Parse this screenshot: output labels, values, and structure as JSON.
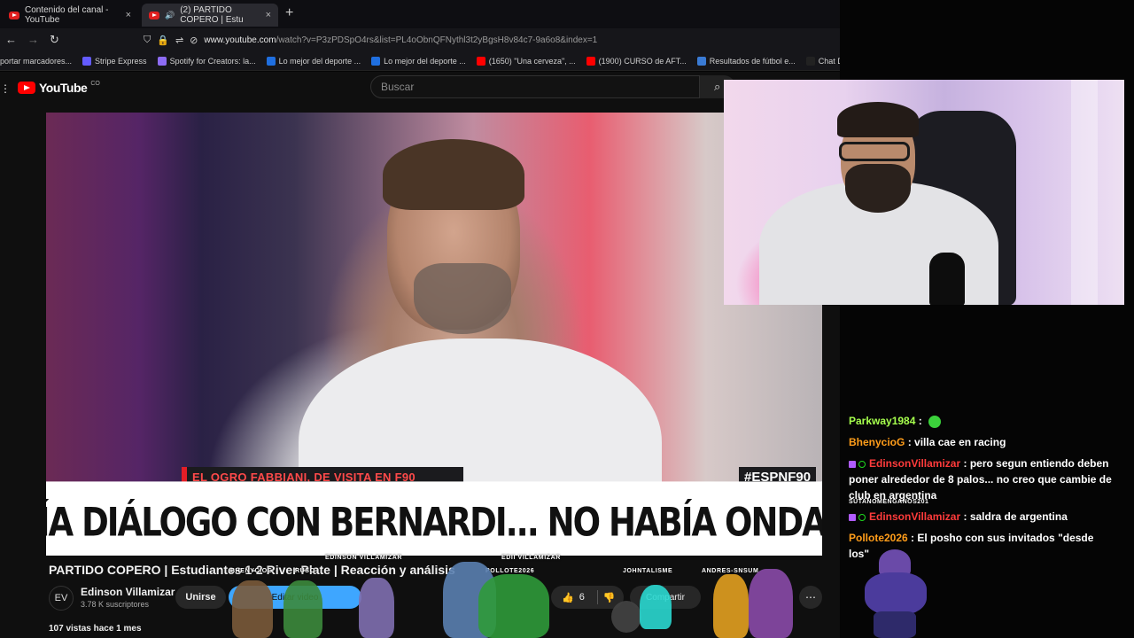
{
  "browser": {
    "tabs": [
      {
        "title": "Contenido del canal - YouTube",
        "close": "×"
      },
      {
        "title": "(2) PARTIDO COPERO | Estu",
        "close": "×"
      }
    ],
    "new_tab": "+",
    "url_host": "www.youtube.com",
    "url_path": "/watch?v=P3zPDSpO4rs&list=PL4oObnQFNythl3t2yBgsH8v84c7-9a6o8&index=1",
    "bookmarks": [
      {
        "label": "portar marcadores...",
        "color": "#777777"
      },
      {
        "label": "Stripe Express",
        "color": "#635bff"
      },
      {
        "label": "Spotify for Creators: la...",
        "color": "#8d6cf5"
      },
      {
        "label": "Lo mejor del deporte ...",
        "color": "#1f6fe0"
      },
      {
        "label": "Lo mejor del deporte ...",
        "color": "#1f6fe0"
      },
      {
        "label": "(1650) \"Una cerveza\", ...",
        "color": "#ff0000"
      },
      {
        "label": "(1900) CURSO de AFT...",
        "color": "#ff0000"
      },
      {
        "label": "Resultados de fútbol e...",
        "color": "#3a7bd5"
      },
      {
        "label": "Chat Dashboard by C...",
        "color": "#222222"
      }
    ]
  },
  "youtube": {
    "logo": "YouTube",
    "logo_sup": "CO",
    "search_placeholder": "Buscar",
    "video": {
      "lower_third": "EL OGRO FABBIANI, DE VISITA EN F90",
      "hashtag": "#ESPNF90",
      "quote": "\"NO TENÍA DIÁLOGO CON BERNARDI... NO HABÍA ONDA CON ÉL\""
    },
    "title": "PARTIDO COPERO | Estudiantes 1-2 River Plate | Reacción y análisis",
    "channel": {
      "name": "Edinson Villamizar",
      "subs": "3.78 K suscriptores",
      "join": "Unirse",
      "subscribe": "Editar video",
      "likes": "6",
      "share": "Compartir"
    },
    "views": "107 vistas  hace 1 mes"
  },
  "chat": [
    {
      "user": "Parkway1984",
      "color": "#a6ff4d",
      "text": "",
      "emote": true
    },
    {
      "user": "BhenycioG",
      "color": "#ff9d1a",
      "text": "villa cae en racing"
    },
    {
      "user": "EdinsonVillamizar",
      "color": "#ff3b3b",
      "text": "pero segun entiendo deben poner alrededor de 8 palos... no creo que cambie de club en argentina",
      "badges": true
    },
    {
      "user": "EdinsonVillamizar",
      "color": "#ff3b3b",
      "text": "saldra de argentina",
      "badges": true
    },
    {
      "user": "Pollote2026",
      "color": "#ff9d1a",
      "text": "El posho con sus invitados \"desde los\""
    }
  ],
  "overlay_names": {
    "chat_tag": "SUTANOMENGANOS201",
    "n1": "EDINSON VILLAMIZAR",
    "n2": "BHENYCIOG",
    "n3": "RUSO",
    "n4": "EDII VILLAMIZAR",
    "n5": "POLLOTE2026",
    "n6": "JOHNTALISME",
    "n7": "ANDRES-SNSUM"
  },
  "colors": {
    "yt_red": "#ff0000",
    "subscribe_blue": "#3ea6ff",
    "espn_red": "#e41e26"
  }
}
